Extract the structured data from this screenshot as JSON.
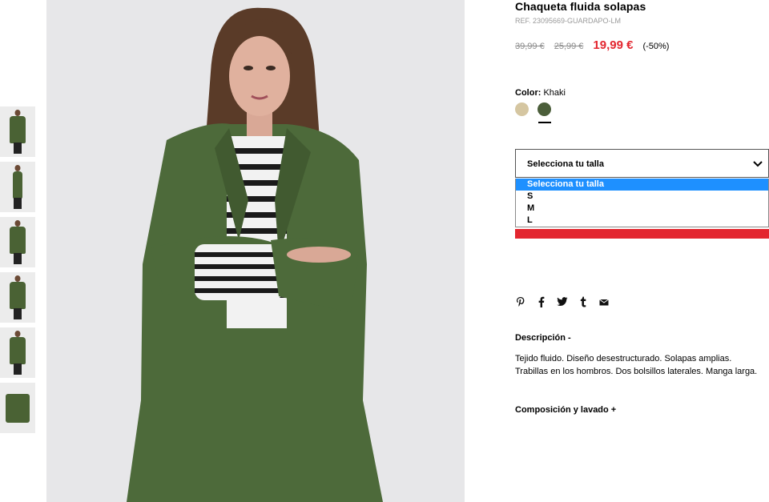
{
  "product": {
    "title": "Chaqueta fluida solapas",
    "ref": "REF. 23095669-GUARDAPO-LM",
    "price_original": "39,99 €",
    "price_previous": "25,99 €",
    "price_sale": "19,99 €",
    "discount": "(-50%)"
  },
  "color": {
    "label": "Color:",
    "value": "Khaki",
    "swatches": [
      {
        "name": "beige",
        "hex": "#d5c6a1"
      },
      {
        "name": "khaki",
        "hex": "#4b5e3a"
      }
    ]
  },
  "size": {
    "placeholder": "Selecciona tu talla",
    "options": [
      "Selecciona tu talla",
      "S",
      "M",
      "L"
    ]
  },
  "share_icons": [
    "pinterest-icon",
    "facebook-icon",
    "twitter-icon",
    "tumblr-icon",
    "email-icon"
  ],
  "description": {
    "heading": "Descripción -",
    "line1": "Tejido fluido. Diseño desestructurado. Solapas amplias.",
    "line2": "Trabillas en los hombros. Dos bolsillos laterales. Manga larga."
  },
  "composition": {
    "heading": "Composición y lavado +"
  },
  "colors": {
    "sale_red": "#e3262f",
    "highlight_blue": "#1e90ff"
  }
}
